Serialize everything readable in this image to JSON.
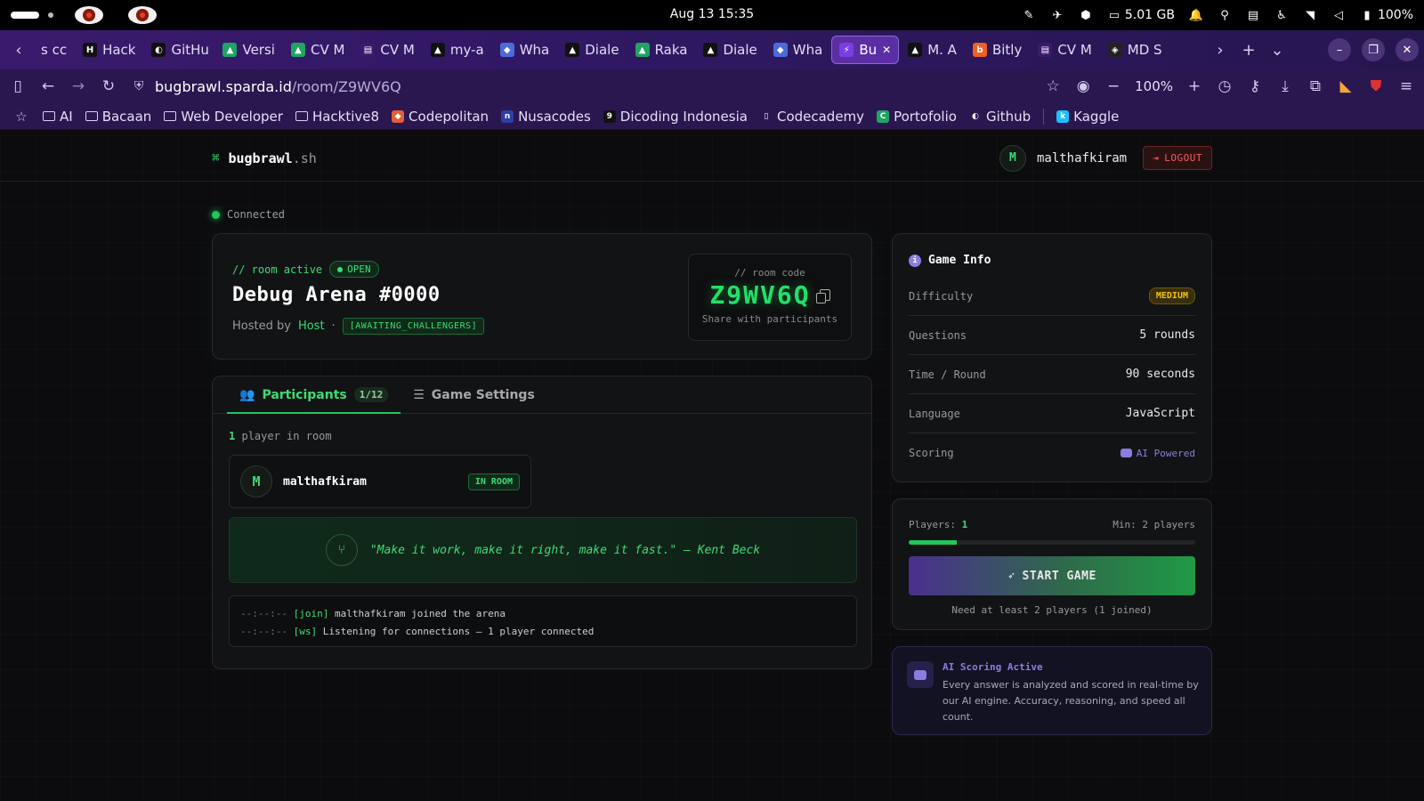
{
  "os": {
    "datetime": "Aug 13  15:35",
    "ram": "5.01 GB",
    "battery": "100%"
  },
  "tabs": [
    {
      "label": "s cc",
      "fav": "",
      "color": "#3a1a6c"
    },
    {
      "label": "Hack",
      "fav": "H",
      "color": "#111"
    },
    {
      "label": "GitHu",
      "fav": "◐",
      "color": "#111"
    },
    {
      "label": "Versi",
      "fav": "▲",
      "color": "#1fa463"
    },
    {
      "label": "CV M",
      "fav": "▲",
      "color": "#1fa463"
    },
    {
      "label": "CV M",
      "fav": "▤",
      "color": "#3a1a6c"
    },
    {
      "label": "my-a",
      "fav": "▲",
      "color": "#111"
    },
    {
      "label": "Wha",
      "fav": "◆",
      "color": "#4b6bd8"
    },
    {
      "label": "Diale",
      "fav": "▲",
      "color": "#111"
    },
    {
      "label": "Raka",
      "fav": "▲",
      "color": "#1fa463"
    },
    {
      "label": "Diale",
      "fav": "▲",
      "color": "#111"
    },
    {
      "label": "Wha",
      "fav": "◆",
      "color": "#4b6bd8"
    },
    {
      "label": "Bu",
      "fav": "⚡",
      "color": "#7a3fe0",
      "active": true
    },
    {
      "label": "M. A",
      "fav": "▲",
      "color": "#111"
    },
    {
      "label": "Bitly",
      "fav": "b",
      "color": "#ee6123"
    },
    {
      "label": "CV M",
      "fav": "▤",
      "color": "#3a1a6c"
    },
    {
      "label": "MD S",
      "fav": "◈",
      "color": "#222"
    }
  ],
  "address": {
    "host": "bugbrawl.sparda.id",
    "path": "/room/Z9WV6Q",
    "zoom": "100%"
  },
  "bookmarks": [
    {
      "label": "AI",
      "type": "folder"
    },
    {
      "label": "Bacaan",
      "type": "folder"
    },
    {
      "label": "Web Developer",
      "type": "folder"
    },
    {
      "label": "Hacktive8",
      "type": "folder"
    },
    {
      "label": "Codepolitan",
      "type": "fav",
      "icon": "◆",
      "color": "#e0603a"
    },
    {
      "label": "Nusacodes",
      "type": "fav",
      "icon": "n",
      "color": "#2c3fa8"
    },
    {
      "label": "Dicoding Indonesia",
      "type": "fav",
      "icon": "9",
      "color": "#111"
    },
    {
      "label": "Codecademy",
      "type": "fav",
      "icon": "▯",
      "color": "#2a1750"
    },
    {
      "label": "Portofolio",
      "type": "fav",
      "icon": "C",
      "color": "#1fa463"
    },
    {
      "label": "Github",
      "type": "fav",
      "icon": "◐",
      "color": "#2a1750"
    },
    {
      "label": "Kaggle",
      "type": "fav",
      "icon": "k",
      "color": "#20beff"
    }
  ],
  "app": {
    "brand_name": "bugbrawl",
    "brand_ext": ".sh",
    "user_initial": "M",
    "username": "malthafkiram",
    "logout": "LOGOUT",
    "connection": "Connected"
  },
  "room": {
    "tagline": "// room active",
    "status": "OPEN",
    "title": "Debug Arena #0000",
    "hosted_by": "Hosted by",
    "host": "Host",
    "separator": "·",
    "state": "[AWAITING_CHALLENGERS]",
    "code_label": "// room code",
    "code": "Z9WV6Q",
    "share": "Share with participants"
  },
  "panel": {
    "tab_participants": "Participants",
    "participants_count": "1/12",
    "tab_settings": "Game Settings",
    "count_num": "1",
    "count_text": "player in room",
    "player_initial": "M",
    "player_name": "malthafkiram",
    "player_status": "IN ROOM",
    "quote": "\"Make it work, make it right, make it fast.\" — Kent Beck",
    "log": [
      {
        "ts": "--:--:--",
        "tag": "[join]",
        "msg": "malthafkiram joined the arena"
      },
      {
        "ts": "--:--:--",
        "tag": "[ws]",
        "msg": "Listening for connections — 1 player connected"
      }
    ]
  },
  "game_info": {
    "title": "Game Info",
    "difficulty_label": "Difficulty",
    "difficulty": "MEDIUM",
    "questions_label": "Questions",
    "questions": "5 rounds",
    "time_label": "Time / Round",
    "time": "90 seconds",
    "language_label": "Language",
    "language": "JavaScript",
    "scoring_label": "Scoring",
    "scoring": "AI Powered"
  },
  "players": {
    "label": "Players:",
    "count": "1",
    "min": "Min: 2 players",
    "progress": 0.167,
    "start": "START GAME",
    "need": "Need at least 2 players (1 joined)"
  },
  "ai_box": {
    "title": "AI Scoring Active",
    "text": "Every answer is analyzed and scored in real-time by our AI engine. Accuracy, reasoning, and speed all count."
  }
}
